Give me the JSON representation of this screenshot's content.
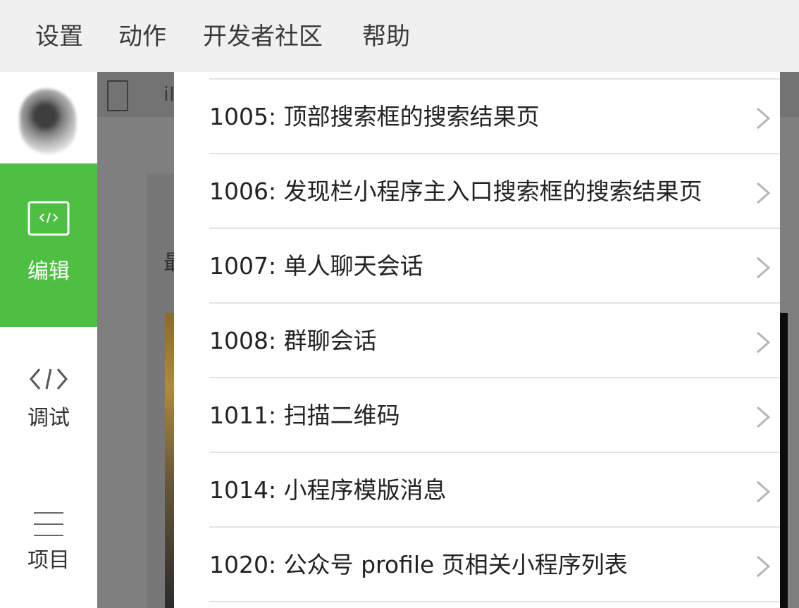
{
  "menu": {
    "items": [
      "设置",
      "动作",
      "开发者社区",
      "帮助"
    ]
  },
  "sidebar": {
    "items": [
      {
        "label": "编辑",
        "icon": "code-window-icon",
        "active": true
      },
      {
        "label": "调试",
        "icon": "code-brackets-icon",
        "active": false
      },
      {
        "label": "项目",
        "icon": "hamburger-menu-icon",
        "active": false
      }
    ]
  },
  "workspace": {
    "device_label": "iP",
    "preview_glyph": "最"
  },
  "list": {
    "rows": [
      {
        "label": "1005: 顶部搜索框的搜索结果页"
      },
      {
        "label": "1006: 发现栏小程序主入口搜索框的搜索结果页"
      },
      {
        "label": "1007: 单人聊天会话"
      },
      {
        "label": "1008: 群聊会话"
      },
      {
        "label": "1011: 扫描二维码"
      },
      {
        "label": "1014: 小程序模版消息"
      },
      {
        "label": "1020: 公众号 profile 页相关小程序列表"
      }
    ]
  },
  "colors": {
    "accent_green": "#4dbf43",
    "overlay_dim": "#7f7f7f",
    "divider": "#e3e3e3"
  }
}
